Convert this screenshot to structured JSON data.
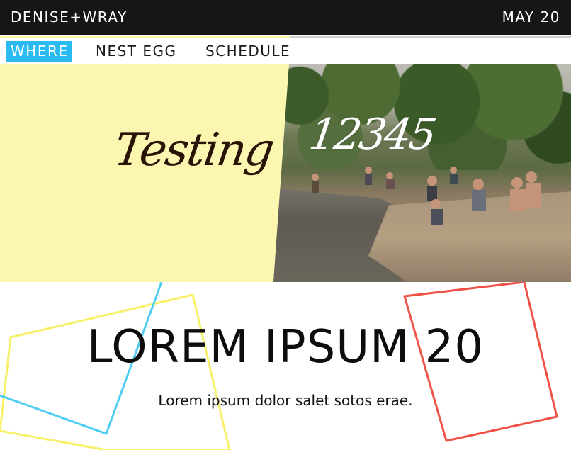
{
  "header": {
    "brand": "DENISE+WRAY",
    "date": "MAY 20"
  },
  "nav": {
    "items": [
      {
        "label": "WHERE",
        "active": true
      },
      {
        "label": "NEST EGG",
        "active": false
      },
      {
        "label": "SCHEDULE",
        "active": false
      }
    ]
  },
  "hero": {
    "script_left": "Testing",
    "script_right": "12345"
  },
  "main": {
    "headline": "LOREM IPSUM 20",
    "subline": "Lorem ipsum dolor salet sotos erae."
  },
  "colors": {
    "accent": "#2bbbf0",
    "yellow": "#fbf7b1",
    "red": "#ef5146",
    "dark_bar": "#161616"
  }
}
